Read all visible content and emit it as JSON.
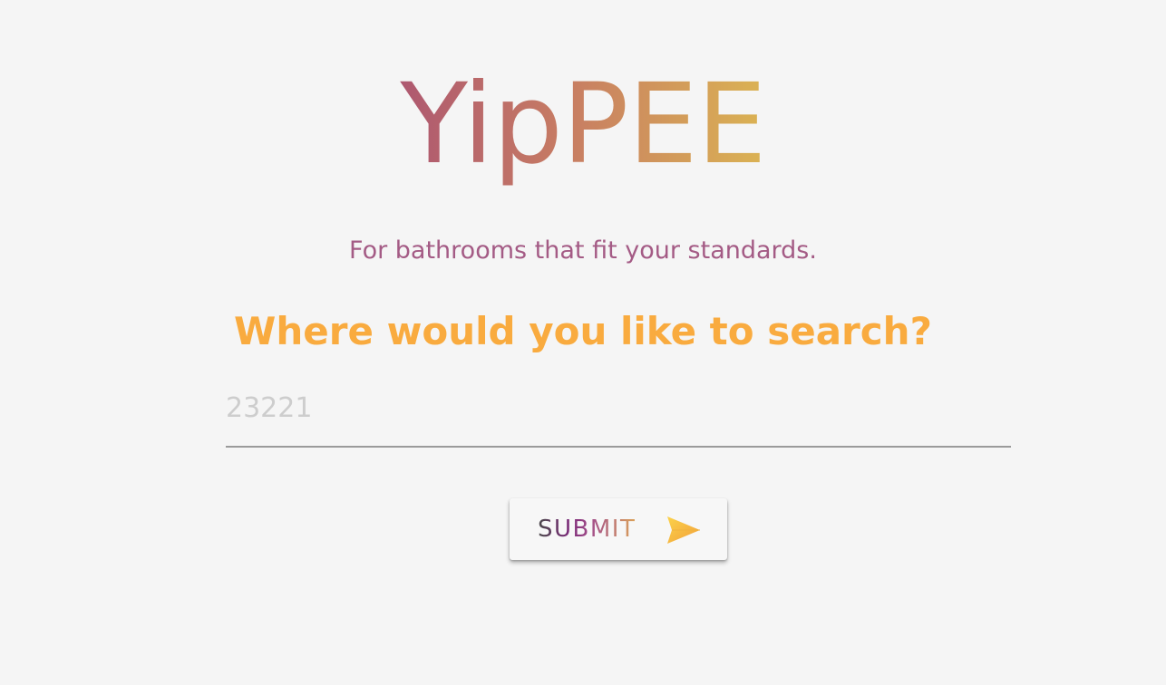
{
  "app": {
    "title": "YipPEE",
    "tagline": "For bathrooms that fit your standards.",
    "question": "Where would you like to search?"
  },
  "search": {
    "placeholder": "23221",
    "value": ""
  },
  "submit": {
    "label": "SUBMIT",
    "icon": "send-icon"
  },
  "colors": {
    "background": "#f5f5f5",
    "title_gradient_start": "#ae5870",
    "title_gradient_end": "#dbb353",
    "tagline": "#a45b85",
    "question": "#f9ab3f",
    "icon_start": "#f9c33f",
    "icon_end": "#f2a03a"
  }
}
